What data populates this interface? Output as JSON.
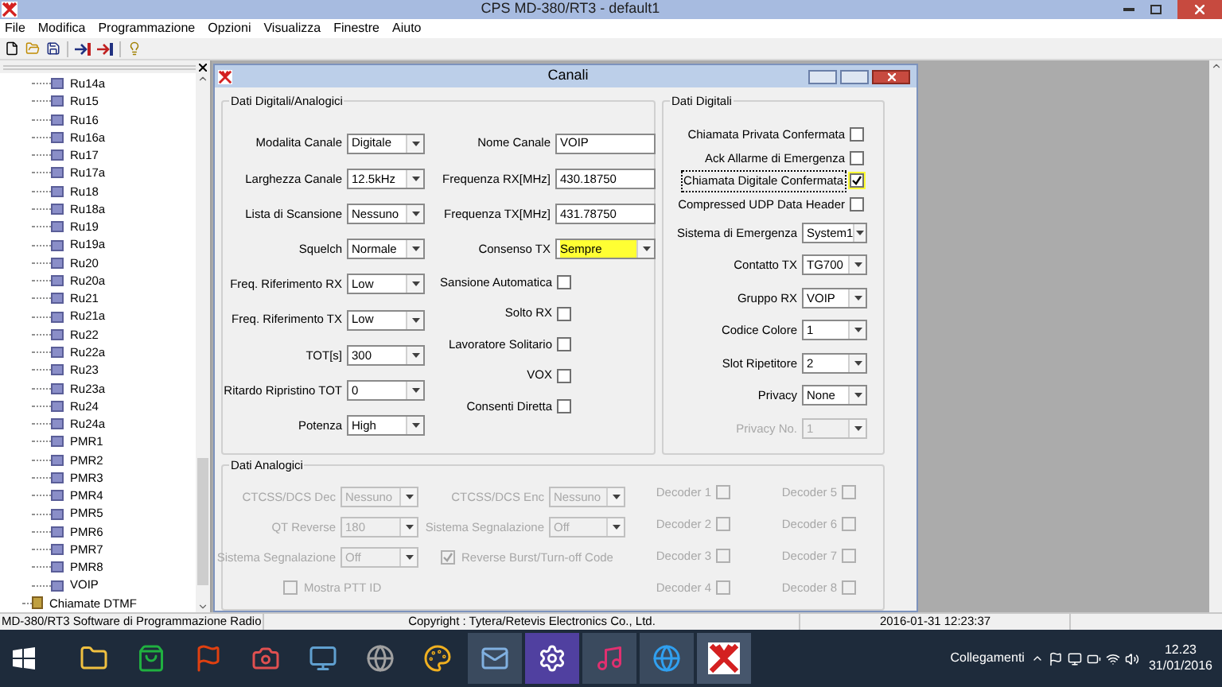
{
  "window": {
    "title": "CPS MD-380/RT3 - default1"
  },
  "menu": [
    "File",
    "Modifica",
    "Programmazione",
    "Opzioni",
    "Visualizza",
    "Finestre",
    "Aiuto"
  ],
  "tree": {
    "channels": [
      {
        "label": "Ru14a"
      },
      {
        "label": "Ru15"
      },
      {
        "label": "Ru16"
      },
      {
        "label": "Ru16a"
      },
      {
        "label": "Ru17"
      },
      {
        "label": "Ru17a"
      },
      {
        "label": "Ru18"
      },
      {
        "label": "Ru18a"
      },
      {
        "label": "Ru19"
      },
      {
        "label": "Ru19a"
      },
      {
        "label": "Ru20"
      },
      {
        "label": "Ru20a"
      },
      {
        "label": "Ru21"
      },
      {
        "label": "Ru21a"
      },
      {
        "label": "Ru22"
      },
      {
        "label": "Ru22a"
      },
      {
        "label": "Ru23"
      },
      {
        "label": "Ru23a"
      },
      {
        "label": "Ru24"
      },
      {
        "label": "Ru24a"
      },
      {
        "label": "PMR1"
      },
      {
        "label": "PMR2"
      },
      {
        "label": "PMR3"
      },
      {
        "label": "PMR4"
      },
      {
        "label": "PMR5"
      },
      {
        "label": "PMR6"
      },
      {
        "label": "PMR7"
      },
      {
        "label": "PMR8"
      },
      {
        "label": "VOIP"
      }
    ],
    "after": [
      {
        "label": "Chiamate DTMF"
      }
    ]
  },
  "dialog": {
    "title": "Canali",
    "digital_analog": {
      "title": "Dati Digitali/Analogici",
      "column_1": [
        {
          "kind": "select",
          "label": "Modalita Canale",
          "value": "Digitale"
        },
        {
          "kind": "select",
          "label": "Larghezza Canale",
          "value": "12.5kHz"
        },
        {
          "kind": "select",
          "label": "Lista di Scansione",
          "value": "Nessuno"
        },
        {
          "kind": "select",
          "label": "Squelch",
          "value": "Normale"
        },
        {
          "kind": "select",
          "label": "Freq. Riferimento RX",
          "value": "Low"
        },
        {
          "kind": "select",
          "label": "Freq. Riferimento TX",
          "value": "Low"
        },
        {
          "kind": "select",
          "label": "TOT[s]",
          "value": "300"
        },
        {
          "kind": "select",
          "label": "Ritardo Ripristino TOT",
          "value": "0"
        },
        {
          "kind": "select",
          "label": "Potenza",
          "value": "High"
        }
      ],
      "column_2": [
        {
          "kind": "text",
          "label": "Nome Canale",
          "value": "VOIP",
          "highlighted": false
        },
        {
          "kind": "text",
          "label": "Frequenza RX[MHz]",
          "value": "430.18750",
          "highlighted": false
        },
        {
          "kind": "text",
          "label": "Frequenza TX[MHz]",
          "value": "431.78750",
          "highlighted": false
        },
        {
          "kind": "select",
          "label": "Consenso TX",
          "value": "Sempre",
          "highlighted": true
        },
        {
          "kind": "checkbox",
          "label": "Sansione Automatica",
          "checked": false,
          "highlighted": false
        },
        {
          "kind": "checkbox",
          "label": "Solto RX",
          "checked": false,
          "highlighted": false
        },
        {
          "kind": "checkbox",
          "label": "Lavoratore Solitario",
          "checked": false,
          "highlighted": false
        },
        {
          "kind": "checkbox",
          "label": "VOX",
          "checked": false,
          "highlighted": false
        },
        {
          "kind": "checkbox",
          "label": "Consenti Diretta",
          "checked": false,
          "highlighted": false
        }
      ]
    },
    "digital": {
      "title": "Dati Digitali",
      "items": [
        {
          "kind": "checkbox",
          "label": "Chiamata Privata Confermata",
          "checked": false,
          "highlighted": false,
          "disabled": false
        },
        {
          "kind": "checkbox",
          "label": "Ack Allarme di Emergenza",
          "checked": false,
          "highlighted": false,
          "disabled": false
        },
        {
          "kind": "checkbox",
          "label": "Chiamata Digitale Confermata",
          "checked": true,
          "highlighted": true,
          "disabled": false
        },
        {
          "kind": "checkbox",
          "label": "Compressed UDP Data Header",
          "checked": false,
          "highlighted": false,
          "disabled": false
        },
        {
          "kind": "select",
          "label": "Sistema di Emergenza",
          "value": "System1",
          "highlighted": false,
          "disabled": false
        },
        {
          "kind": "select",
          "label": "Contatto TX",
          "value": "TG700",
          "highlighted": false,
          "disabled": false
        },
        {
          "kind": "select",
          "label": "Gruppo RX",
          "value": "VOIP",
          "highlighted": false,
          "disabled": false
        },
        {
          "kind": "select",
          "label": "Codice Colore",
          "value": "1",
          "highlighted": false,
          "disabled": false
        },
        {
          "kind": "select",
          "label": "Slot Ripetitore",
          "value": "2",
          "highlighted": false,
          "disabled": false
        },
        {
          "kind": "select",
          "label": "Privacy",
          "value": "None",
          "highlighted": false,
          "disabled": false
        },
        {
          "kind": "select",
          "label": "Privacy No.",
          "value": "1",
          "highlighted": false,
          "disabled": true
        }
      ]
    },
    "analog": {
      "title": "Dati Analogici",
      "disabled": true,
      "column_1": [
        {
          "kind": "select",
          "label": "CTCSS/DCS Dec",
          "value": "Nessuno"
        },
        {
          "kind": "select",
          "label": "QT Reverse",
          "value": "180"
        },
        {
          "kind": "select",
          "label": "Sistema Segnalazione",
          "value": "Off"
        },
        {
          "kind": "checkbox_left",
          "label": "Mostra PTT ID",
          "checked": false
        }
      ],
      "column_2": [
        {
          "kind": "select",
          "label": "CTCSS/DCS Enc",
          "value": "Nessuno"
        },
        {
          "kind": "select",
          "label": "Sistema Segnalazione",
          "value": "Off"
        },
        {
          "kind": "checkbox_left",
          "label": "Reverse Burst/Turn-off Code",
          "checked": true
        }
      ],
      "decoders": [
        {
          "label": "Decoder 1",
          "checked": false
        },
        {
          "label": "Decoder 2",
          "checked": false
        },
        {
          "label": "Decoder 3",
          "checked": false
        },
        {
          "label": "Decoder 4",
          "checked": false
        },
        {
          "label": "Decoder 5",
          "checked": false
        },
        {
          "label": "Decoder 6",
          "checked": false
        },
        {
          "label": "Decoder 7",
          "checked": false
        },
        {
          "label": "Decoder 8",
          "checked": false
        }
      ]
    }
  },
  "status_bar": [
    "MD-380/RT3 Software di Programmazione Radio",
    "Copyright : Tytera/Retevis Electronics Co., Ltd.",
    "2016-01-31 12:23:37"
  ],
  "taskbar": {
    "tray_label": "Collegamenti",
    "time": "12.23",
    "date": "31/01/2016"
  }
}
